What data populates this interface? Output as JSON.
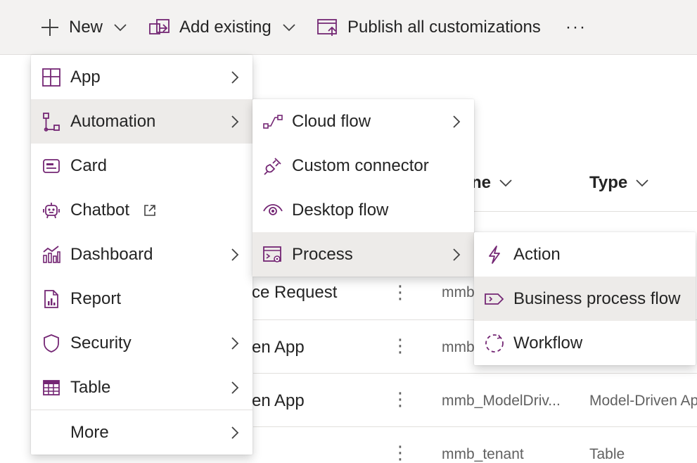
{
  "command_bar": {
    "new_label": "New",
    "add_existing_label": "Add existing",
    "publish_label": "Publish all customizations",
    "more_label": "···"
  },
  "background": {
    "columns": [
      {
        "label": "ne"
      },
      {
        "label": "Type"
      }
    ],
    "rows": [
      {
        "name": "ce Request",
        "col2": "mmb",
        "col3": ""
      },
      {
        "name": "en App",
        "col2": "mmb",
        "col3": ""
      },
      {
        "name": "en App",
        "col2": "mmb_ModelDriv...",
        "col3": "Model-Driven Ap"
      },
      {
        "name": "",
        "col2": "mmb_tenant",
        "col3": "Table"
      }
    ],
    "row_menu_glyph": "⋮"
  },
  "menu_new": {
    "items": [
      {
        "label": "App",
        "icon": "app-grid-icon",
        "has_submenu": true
      },
      {
        "label": "Automation",
        "icon": "automation-icon",
        "has_submenu": true
      },
      {
        "label": "Card",
        "icon": "card-icon",
        "has_submenu": false
      },
      {
        "label": "Chatbot",
        "icon": "chatbot-icon",
        "has_submenu": false,
        "external": true
      },
      {
        "label": "Dashboard",
        "icon": "dashboard-icon",
        "has_submenu": true
      },
      {
        "label": "Report",
        "icon": "report-icon",
        "has_submenu": false
      },
      {
        "label": "Security",
        "icon": "shield-icon",
        "has_submenu": true
      },
      {
        "label": "Table",
        "icon": "table-icon",
        "has_submenu": true
      },
      {
        "label": "More",
        "icon": "",
        "has_submenu": true
      }
    ]
  },
  "menu_automation": {
    "items": [
      {
        "label": "Cloud flow",
        "icon": "cloud-flow-icon",
        "has_submenu": true
      },
      {
        "label": "Custom connector",
        "icon": "plug-icon",
        "has_submenu": false
      },
      {
        "label": "Desktop flow",
        "icon": "eye-icon",
        "has_submenu": false
      },
      {
        "label": "Process",
        "icon": "process-icon",
        "has_submenu": true
      }
    ]
  },
  "menu_process": {
    "items": [
      {
        "label": "Action",
        "icon": "lightning-icon"
      },
      {
        "label": "Business process flow",
        "icon": "business-process-flow-icon"
      },
      {
        "label": "Workflow",
        "icon": "workflow-icon"
      }
    ]
  },
  "colors": {
    "icon_purple": "#742774",
    "hover_bg": "#edebe9",
    "bar_bg": "#f3f2f1"
  }
}
